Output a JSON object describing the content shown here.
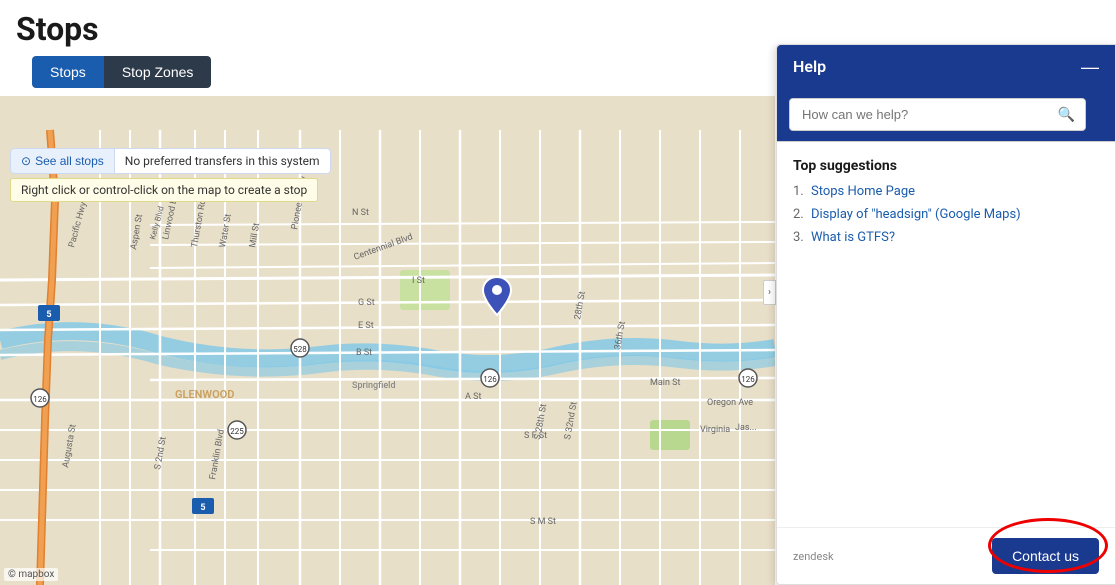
{
  "page": {
    "title": "Stops"
  },
  "tabs": [
    {
      "id": "stops",
      "label": "Stops",
      "active": true
    },
    {
      "id": "stop-zones",
      "label": "Stop Zones",
      "active": false
    }
  ],
  "controls": {
    "see_all_label": "See all stops",
    "no_transfers_label": "No preferred transfers in this system",
    "hint_label": "Right click or control-click on the map to create a stop"
  },
  "map": {
    "attribution": "© mapbox"
  },
  "help_panel": {
    "title": "Help",
    "close_label": "—",
    "search_placeholder": "How can we help?",
    "top_suggestions_title": "Top suggestions",
    "suggestions": [
      {
        "num": "1.",
        "text": "Stops Home Page",
        "href": "#"
      },
      {
        "num": "2.",
        "text": "Display of \"headsign\" (Google Maps)",
        "href": "#"
      },
      {
        "num": "3.",
        "text": "What is GTFS?",
        "href": "#"
      }
    ],
    "zendesk_label": "zendesk",
    "contact_us_label": "Contact us"
  }
}
